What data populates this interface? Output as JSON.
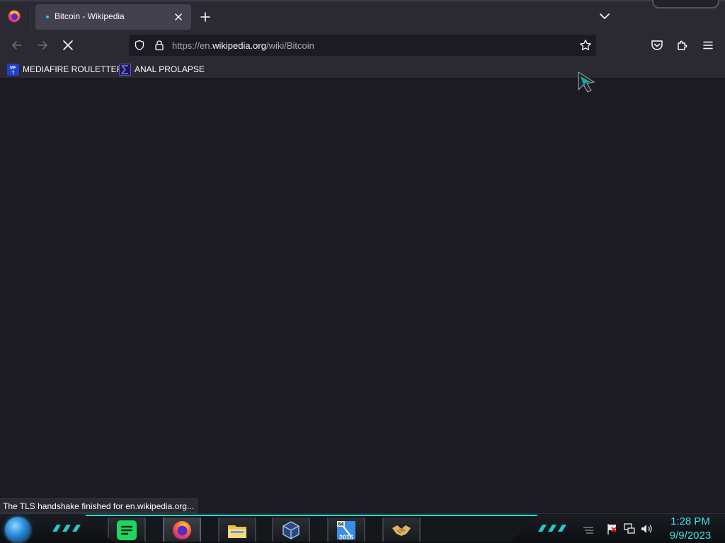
{
  "browser": {
    "tab": {
      "title": "Bitcoin - Wikipedia"
    },
    "url": {
      "prefix": "https://en.",
      "host": "wikipedia.org",
      "path": "/wiki/Bitcoin"
    },
    "bookmarks": [
      {
        "label": "MEDIAFIRE ROULETTER",
        "favicon": "MF-T"
      },
      {
        "label": "ANAL PROLAPSE"
      }
    ],
    "status_text": "The TLS handshake finished for en.wikipedia.org...",
    "icons": {
      "back": "back-arrow-icon",
      "forward": "forward-arrow-icon",
      "stop": "stop-x-icon",
      "shield": "tracking-protection-shield-icon",
      "lock": "lock-icon",
      "star": "bookmark-star-icon",
      "pocket": "pocket-icon",
      "extensions": "extensions-puzzle-icon",
      "menu": "hamburger-menu-icon"
    },
    "colors": {
      "toolbar": "#2b2a33",
      "content": "#1c1b22",
      "accent": "#00ddff"
    }
  },
  "taskbar": {
    "apps": [
      {
        "name": "spotify-icon"
      },
      {
        "name": "firefox-icon",
        "active": true
      },
      {
        "name": "file-explorer-icon"
      },
      {
        "name": "virtualbox-icon"
      },
      {
        "name": "visual-studio-2016-icon",
        "badge_top": "64",
        "badge_bottom": "2016"
      },
      {
        "name": "handshake-icon"
      }
    ],
    "clock": {
      "time": "1:28 PM",
      "date": "9/9/2023"
    },
    "accent": "#3ce0e8"
  }
}
